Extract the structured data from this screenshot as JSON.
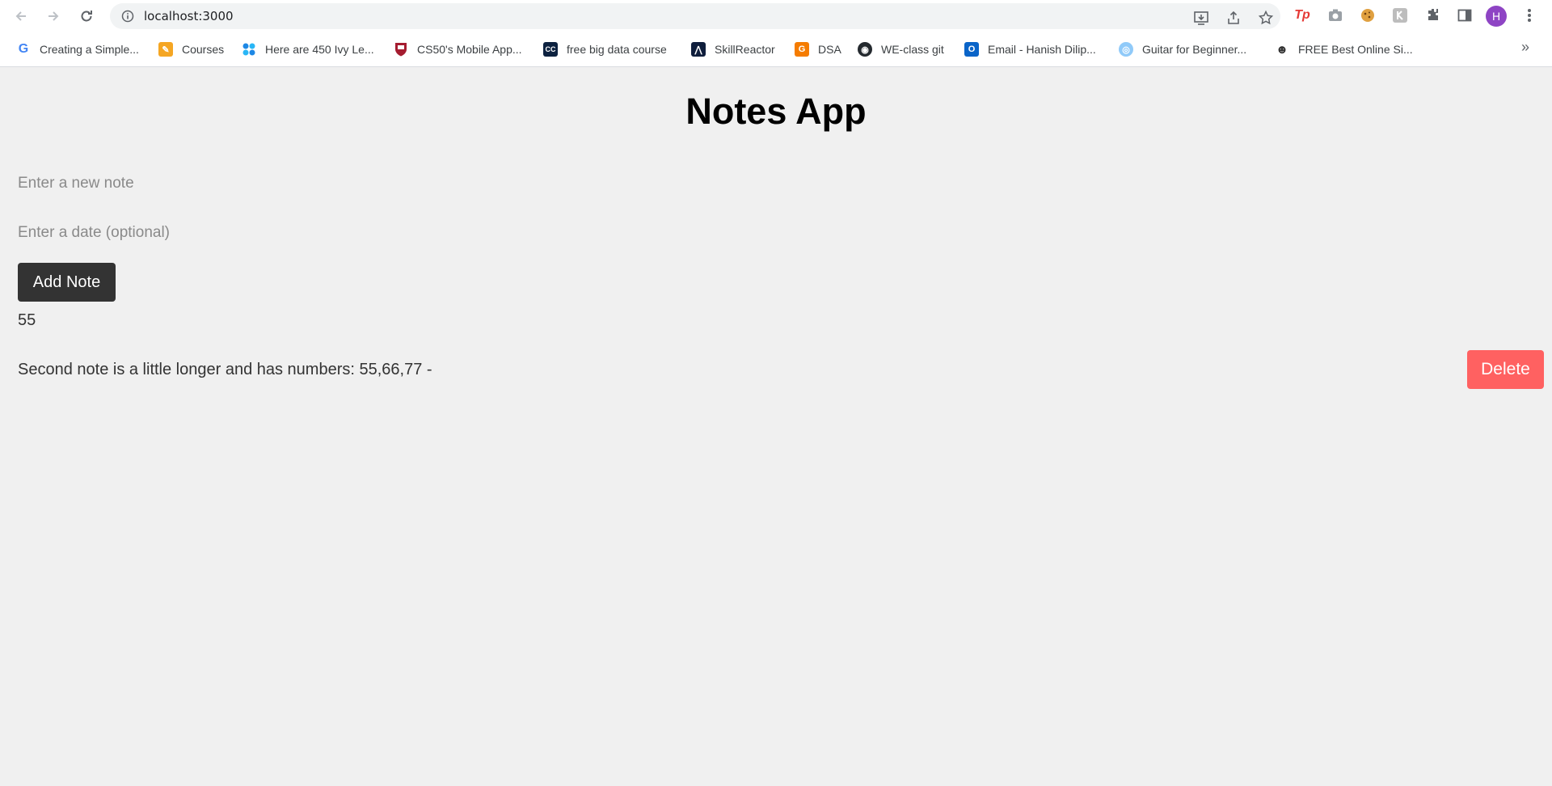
{
  "browser": {
    "url": "localhost:3000",
    "avatar_letter": "H",
    "bookmarks": [
      {
        "label": "Creating a Simple...",
        "icon": "google-icon"
      },
      {
        "label": "Courses",
        "icon": "pencil-icon"
      },
      {
        "label": "Here are 450 Ivy Le...",
        "icon": "dots-icon"
      },
      {
        "label": "CS50's Mobile App...",
        "icon": "harvard-shield-icon"
      },
      {
        "label": "free big data course",
        "icon": "cc-icon"
      },
      {
        "label": "SkillReactor",
        "icon": "skillreactor-icon"
      },
      {
        "label": "DSA",
        "icon": "gfg-icon"
      },
      {
        "label": "WE-class git",
        "icon": "github-icon"
      },
      {
        "label": "Email - Hanish Dilip...",
        "icon": "outlook-icon"
      },
      {
        "label": "Guitar for Beginner...",
        "icon": "globe-icon"
      },
      {
        "label": "FREE Best Online Si...",
        "icon": "person-icon"
      }
    ],
    "more_bookmarks": "»"
  },
  "app": {
    "title": "Notes App",
    "note_placeholder": "Enter a new note",
    "date_placeholder": "Enter a date (optional)",
    "add_label": "Add Note",
    "notes": [
      {
        "text": "55",
        "has_delete": false
      },
      {
        "text": "Second note is a little longer and has numbers: 55,66,77 -",
        "has_delete": true,
        "delete_label": "Delete"
      }
    ]
  },
  "colors": {
    "page_bg": "#f0f0f0",
    "add_button": "#333333",
    "delete_button": "#ff6161",
    "avatar": "#8e44c4"
  }
}
